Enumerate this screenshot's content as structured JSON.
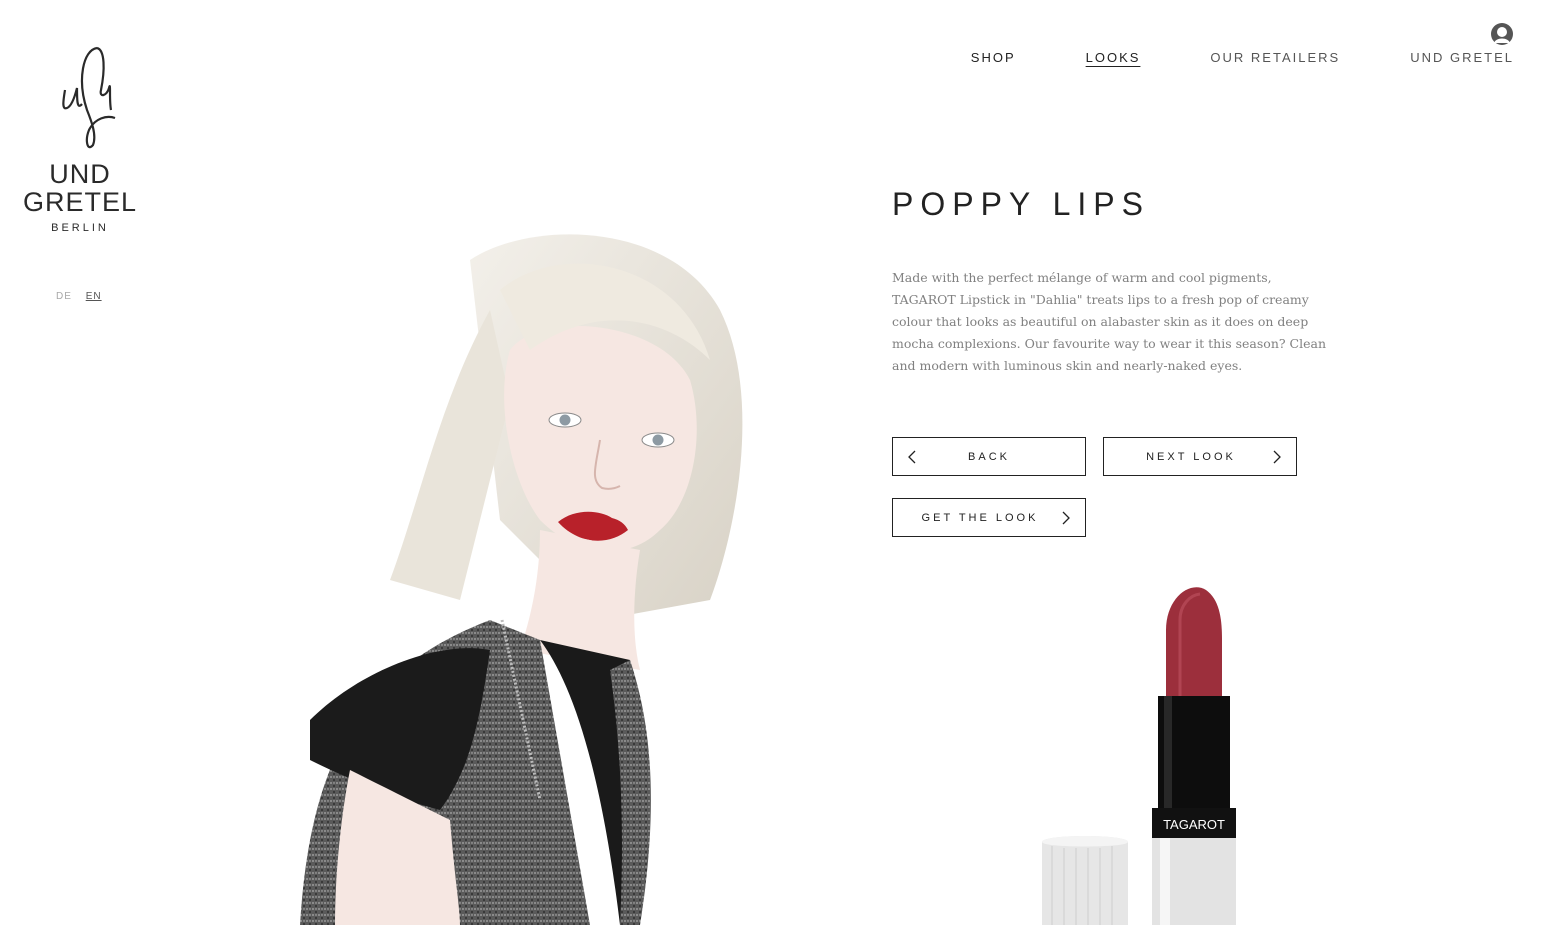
{
  "brand": {
    "monogram": "uG",
    "line1": "UND",
    "line2": "GRETEL",
    "line3": "BERLIN"
  },
  "language": {
    "options": [
      "DE",
      "EN"
    ],
    "selected": "EN"
  },
  "nav": {
    "items": [
      "SHOP",
      "LOOKS",
      "OUR RETAILERS",
      "UND GRETEL"
    ],
    "current": "LOOKS"
  },
  "look": {
    "title": "POPPY LIPS",
    "description": "Made with the perfect mélange of warm and cool pigments, TAGAROT Lipstick in \"Dahlia\" treats lips to a fresh pop of creamy colour that looks as beautiful on alabaster skin as it does on deep mocha complexions. Our favourite way to wear it this season? Clean and modern with luminous skin and nearly-naked eyes."
  },
  "buttons": {
    "back": "BACK",
    "next": "NEXT LOOK",
    "get_look": "GET THE LOOK"
  },
  "product": {
    "label": "TAGAROT"
  },
  "icons": {
    "user": "user-icon",
    "back": "chevron-left-icon",
    "next": "chevron-right-icon"
  },
  "colors": {
    "text": "#222222",
    "muted": "#808080",
    "lipstick": "#9c2f3c"
  }
}
